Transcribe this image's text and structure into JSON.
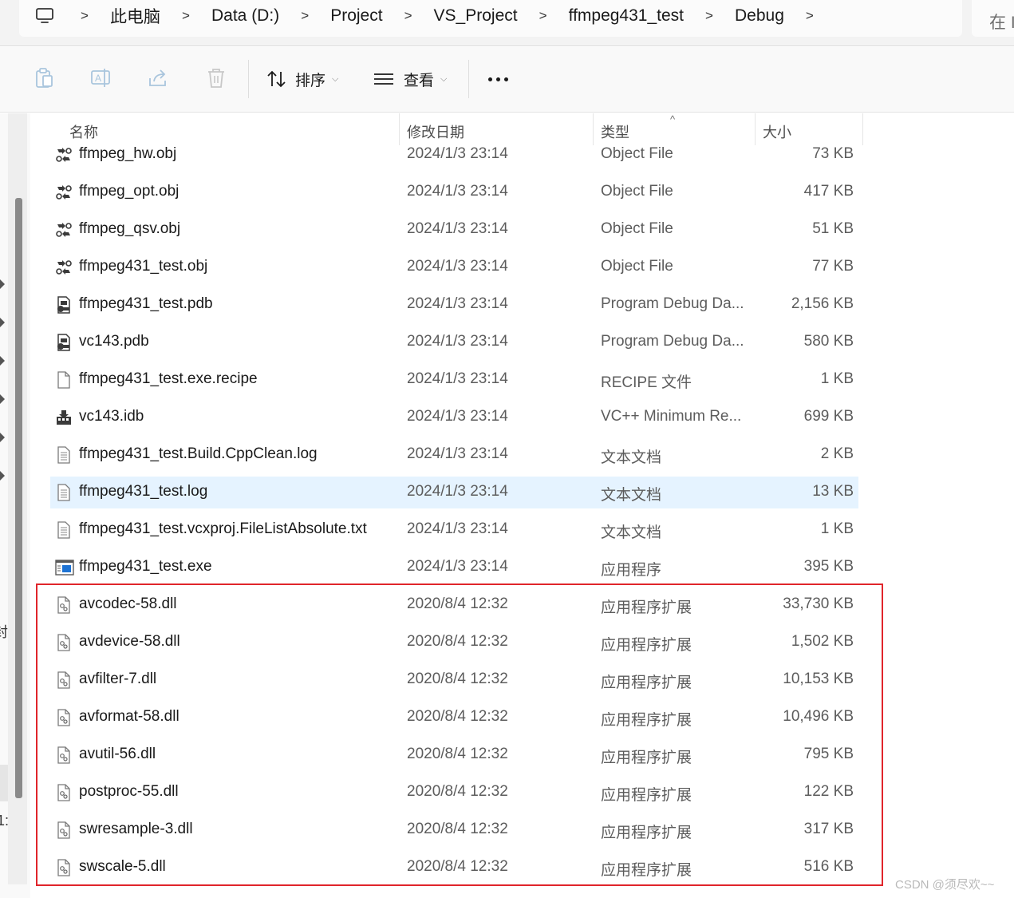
{
  "address_bar": {
    "crumbs": [
      "此电脑",
      "Data (D:)",
      "Project",
      "VS_Project",
      "ffmpeg431_test",
      "Debug"
    ],
    "separator": ">",
    "search_placeholder": "在 I"
  },
  "toolbar": {
    "sort_label": "排序",
    "view_label": "查看",
    "icons": [
      "copy-icon",
      "rename-icon",
      "share-icon",
      "delete-icon",
      "sort-icon",
      "view-icon",
      "more-icon"
    ]
  },
  "columns": {
    "name": "名称",
    "date": "修改日期",
    "type": "类型",
    "size": "大小",
    "sort_indicator": "^"
  },
  "files": [
    {
      "name": "ffmpeg_hw.obj",
      "date": "2024/1/3 23:14",
      "type": "Object File",
      "size": "73 KB",
      "icon": "object-file-icon"
    },
    {
      "name": "ffmpeg_opt.obj",
      "date": "2024/1/3 23:14",
      "type": "Object File",
      "size": "417 KB",
      "icon": "object-file-icon"
    },
    {
      "name": "ffmpeg_qsv.obj",
      "date": "2024/1/3 23:14",
      "type": "Object File",
      "size": "51 KB",
      "icon": "object-file-icon"
    },
    {
      "name": "ffmpeg431_test.obj",
      "date": "2024/1/3 23:14",
      "type": "Object File",
      "size": "77 KB",
      "icon": "object-file-icon"
    },
    {
      "name": "ffmpeg431_test.pdb",
      "date": "2024/1/3 23:14",
      "type": "Program Debug Da...",
      "size": "2,156 KB",
      "icon": "pdb-file-icon"
    },
    {
      "name": "vc143.pdb",
      "date": "2024/1/3 23:14",
      "type": "Program Debug Da...",
      "size": "580 KB",
      "icon": "pdb-file-icon"
    },
    {
      "name": "ffmpeg431_test.exe.recipe",
      "date": "2024/1/3 23:14",
      "type": "RECIPE 文件",
      "size": "1 KB",
      "icon": "blank-file-icon"
    },
    {
      "name": "vc143.idb",
      "date": "2024/1/3 23:14",
      "type": "VC++ Minimum Re...",
      "size": "699 KB",
      "icon": "idb-file-icon"
    },
    {
      "name": "ffmpeg431_test.Build.CppClean.log",
      "date": "2024/1/3 23:14",
      "type": "文本文档",
      "size": "2 KB",
      "icon": "text-file-icon"
    },
    {
      "name": "ffmpeg431_test.log",
      "date": "2024/1/3 23:14",
      "type": "文本文档",
      "size": "13 KB",
      "icon": "text-file-icon",
      "selected": true
    },
    {
      "name": "ffmpeg431_test.vcxproj.FileListAbsolute.txt",
      "date": "2024/1/3 23:14",
      "type": "文本文档",
      "size": "1 KB",
      "icon": "text-file-icon"
    },
    {
      "name": "ffmpeg431_test.exe",
      "date": "2024/1/3 23:14",
      "type": "应用程序",
      "size": "395 KB",
      "icon": "exe-file-icon"
    },
    {
      "name": "avcodec-58.dll",
      "date": "2020/8/4 12:32",
      "type": "应用程序扩展",
      "size": "33,730 KB",
      "icon": "dll-file-icon"
    },
    {
      "name": "avdevice-58.dll",
      "date": "2020/8/4 12:32",
      "type": "应用程序扩展",
      "size": "1,502 KB",
      "icon": "dll-file-icon"
    },
    {
      "name": "avfilter-7.dll",
      "date": "2020/8/4 12:32",
      "type": "应用程序扩展",
      "size": "10,153 KB",
      "icon": "dll-file-icon"
    },
    {
      "name": "avformat-58.dll",
      "date": "2020/8/4 12:32",
      "type": "应用程序扩展",
      "size": "10,496 KB",
      "icon": "dll-file-icon"
    },
    {
      "name": "avutil-56.dll",
      "date": "2020/8/4 12:32",
      "type": "应用程序扩展",
      "size": "795 KB",
      "icon": "dll-file-icon"
    },
    {
      "name": "postproc-55.dll",
      "date": "2020/8/4 12:32",
      "type": "应用程序扩展",
      "size": "122 KB",
      "icon": "dll-file-icon"
    },
    {
      "name": "swresample-3.dll",
      "date": "2020/8/4 12:32",
      "type": "应用程序扩展",
      "size": "317 KB",
      "icon": "dll-file-icon"
    },
    {
      "name": "swscale-5.dll",
      "date": "2020/8/4 12:32",
      "type": "应用程序扩展",
      "size": "516 KB",
      "icon": "dll-file-icon"
    }
  ],
  "nav_pane": {
    "partial_labels": [
      "封",
      "1:"
    ]
  },
  "watermark": "CSDN @须尽欢~~",
  "colors": {
    "selection": "#e5f3ff",
    "highlight_border": "#e0252b",
    "secondary_text": "#5c5c5c"
  }
}
